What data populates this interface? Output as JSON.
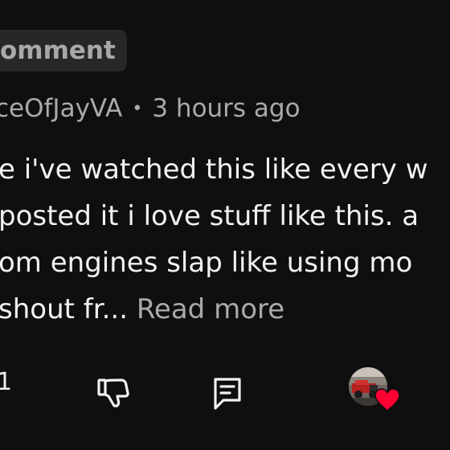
{
  "pinned_chip": {
    "label": "omment"
  },
  "comment": {
    "author": "ceOfJayVA",
    "separator": "•",
    "time": "3 hours ago",
    "lines": [
      "e i've watched this like every w",
      "posted it i love stuff like this. a",
      "om engines slap like using mo"
    ],
    "last_line": "shout fr...",
    "read_more": "Read more"
  },
  "actions": {
    "like_count": "1",
    "dislike_icon": "thumbs-down-icon",
    "reply_icon": "comment-reply-icon",
    "heart_icon": "heart-icon"
  },
  "colors": {
    "background": "#0f0f0f",
    "text_primary": "#f1f1f1",
    "text_secondary": "#aaaaaa",
    "chip_bg": "#272727",
    "heart": "#ff0033"
  }
}
